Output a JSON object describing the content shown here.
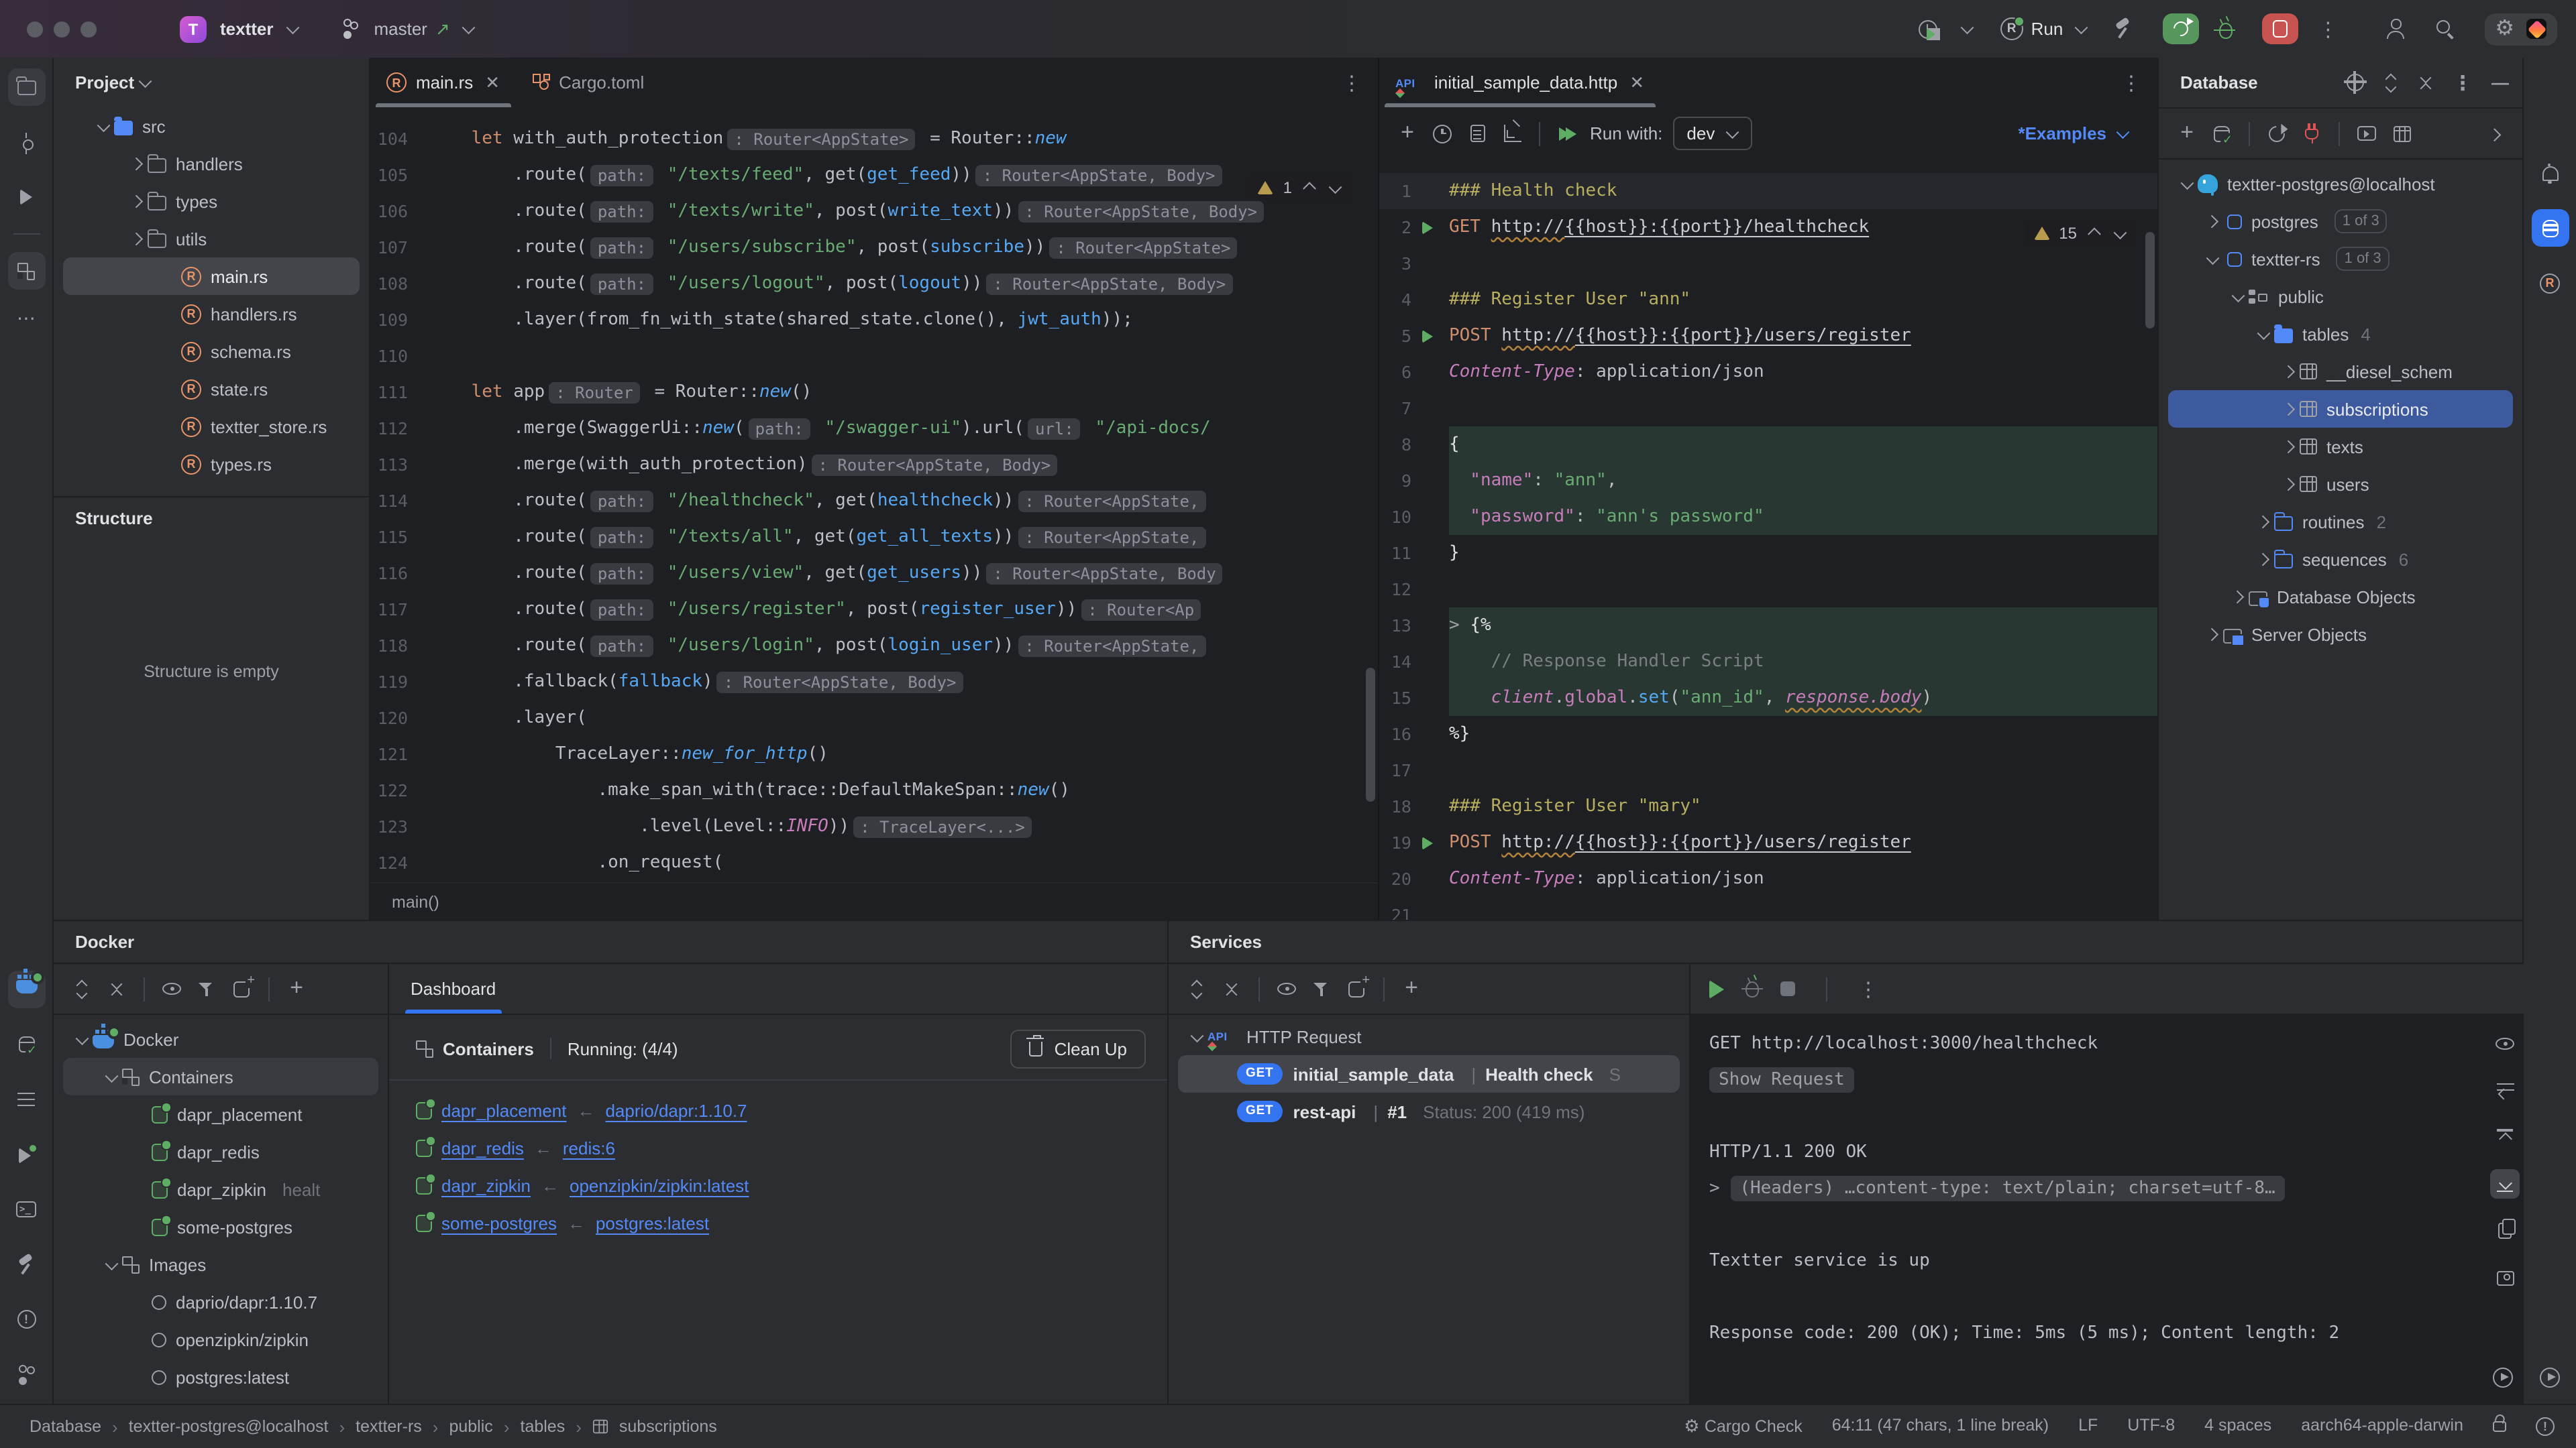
{
  "colors": {
    "accent": "#3574f0",
    "run_green": "#5fad65",
    "stop_red": "#c75450",
    "warning_gold": "#b89b4e",
    "link_blue": "#548af7",
    "selection_blue": "#3d5a9e",
    "panel_bg": "#2b2d30",
    "editor_bg": "#1e1f22"
  },
  "titlebar": {
    "project_initial": "T",
    "project": "textter",
    "branch": "master",
    "run_config": "Run"
  },
  "project_pane": {
    "title": "Project",
    "tree": [
      {
        "i": 0,
        "c": "d",
        "ic": "folder-blue",
        "l": "src"
      },
      {
        "i": 1,
        "c": "r",
        "ic": "folder",
        "l": "handlers"
      },
      {
        "i": 1,
        "c": "r",
        "ic": "folder",
        "l": "types"
      },
      {
        "i": 1,
        "c": "r",
        "ic": "folder",
        "l": "utils"
      },
      {
        "i": 2,
        "ic": "rust",
        "l": "main.rs",
        "sel": true
      },
      {
        "i": 2,
        "ic": "rust",
        "l": "handlers.rs"
      },
      {
        "i": 2,
        "ic": "rust",
        "l": "schema.rs"
      },
      {
        "i": 2,
        "ic": "rust",
        "l": "state.rs"
      },
      {
        "i": 2,
        "ic": "rust",
        "l": "textter_store.rs"
      },
      {
        "i": 2,
        "ic": "rust",
        "l": "types.rs"
      }
    ]
  },
  "structure": {
    "title": "Structure",
    "empty": "Structure is empty"
  },
  "tabs": {
    "main": "main.rs",
    "cargo": "Cargo.toml"
  },
  "code": {
    "warn_count": "1",
    "breadcrumb": "main()",
    "lines": [
      {
        "n": 104,
        "seg": [
          [
            "k",
            "    let "
          ],
          [
            "t",
            "with_auth_protection"
          ],
          [
            "h",
            ": Router<AppState>"
          ],
          [
            "t",
            " = Router::"
          ],
          [
            "fi",
            "new"
          ]
        ]
      },
      {
        "n": 105,
        "seg": [
          [
            "t",
            "        .route("
          ],
          [
            "h",
            "path:"
          ],
          [
            "s",
            " \"/texts/feed\""
          ],
          [
            "t",
            ", get("
          ],
          [
            "f",
            "get_feed"
          ],
          [
            "t",
            "))"
          ],
          [
            "h",
            ": Router<AppState, Body>"
          ]
        ]
      },
      {
        "n": 106,
        "seg": [
          [
            "t",
            "        .route("
          ],
          [
            "h",
            "path:"
          ],
          [
            "s",
            " \"/texts/write\""
          ],
          [
            "t",
            ", post("
          ],
          [
            "f",
            "write_text"
          ],
          [
            "t",
            "))"
          ],
          [
            "h",
            ": Router<AppState, Body>"
          ]
        ]
      },
      {
        "n": 107,
        "seg": [
          [
            "t",
            "        .route("
          ],
          [
            "h",
            "path:"
          ],
          [
            "s",
            " \"/users/subscribe\""
          ],
          [
            "t",
            ", post("
          ],
          [
            "f",
            "subscribe"
          ],
          [
            "t",
            "))"
          ],
          [
            "h",
            ": Router<AppState>"
          ]
        ]
      },
      {
        "n": 108,
        "seg": [
          [
            "t",
            "        .route("
          ],
          [
            "h",
            "path:"
          ],
          [
            "s",
            " \"/users/logout\""
          ],
          [
            "t",
            ", post("
          ],
          [
            "f",
            "logout"
          ],
          [
            "t",
            "))"
          ],
          [
            "h",
            ": Router<AppState, Body>"
          ]
        ]
      },
      {
        "n": 109,
        "seg": [
          [
            "t",
            "        .layer(from_fn_with_state(shared_state.clone(), "
          ],
          [
            "f",
            "jwt_auth"
          ],
          [
            "t",
            "));"
          ]
        ]
      },
      {
        "n": 110,
        "seg": []
      },
      {
        "n": 111,
        "seg": [
          [
            "k",
            "    let "
          ],
          [
            "t",
            "app"
          ],
          [
            "h",
            ": Router"
          ],
          [
            "t",
            " = Router::"
          ],
          [
            "fi",
            "new"
          ],
          [
            "t",
            "()"
          ]
        ]
      },
      {
        "n": 112,
        "seg": [
          [
            "t",
            "        .merge(SwaggerUi::"
          ],
          [
            "fi",
            "new"
          ],
          [
            "t",
            "("
          ],
          [
            "h",
            "path:"
          ],
          [
            "s",
            " \"/swagger-ui\""
          ],
          [
            "t",
            ").url("
          ],
          [
            "h",
            "url:"
          ],
          [
            "s",
            " \"/api-docs/"
          ]
        ]
      },
      {
        "n": 113,
        "seg": [
          [
            "t",
            "        .merge(with_auth_protection)"
          ],
          [
            "h",
            ": Router<AppState, Body>"
          ]
        ]
      },
      {
        "n": 114,
        "seg": [
          [
            "t",
            "        .route("
          ],
          [
            "h",
            "path:"
          ],
          [
            "s",
            " \"/healthcheck\""
          ],
          [
            "t",
            ", get("
          ],
          [
            "f",
            "healthcheck"
          ],
          [
            "t",
            "))"
          ],
          [
            "h",
            ": Router<AppState,"
          ]
        ]
      },
      {
        "n": 115,
        "seg": [
          [
            "t",
            "        .route("
          ],
          [
            "h",
            "path:"
          ],
          [
            "s",
            " \"/texts/all\""
          ],
          [
            "t",
            ", get("
          ],
          [
            "f",
            "get_all_texts"
          ],
          [
            "t",
            "))"
          ],
          [
            "h",
            ": Router<AppState,"
          ]
        ]
      },
      {
        "n": 116,
        "seg": [
          [
            "t",
            "        .route("
          ],
          [
            "h",
            "path:"
          ],
          [
            "s",
            " \"/users/view\""
          ],
          [
            "t",
            ", get("
          ],
          [
            "f",
            "get_users"
          ],
          [
            "t",
            "))"
          ],
          [
            "h",
            ": Router<AppState, Body"
          ]
        ]
      },
      {
        "n": 117,
        "seg": [
          [
            "t",
            "        .route("
          ],
          [
            "h",
            "path:"
          ],
          [
            "s",
            " \"/users/register\""
          ],
          [
            "t",
            ", post("
          ],
          [
            "f",
            "register_user"
          ],
          [
            "t",
            "))"
          ],
          [
            "h",
            ": Router<Ap"
          ]
        ]
      },
      {
        "n": 118,
        "seg": [
          [
            "t",
            "        .route("
          ],
          [
            "h",
            "path:"
          ],
          [
            "s",
            " \"/users/login\""
          ],
          [
            "t",
            ", post("
          ],
          [
            "f",
            "login_user"
          ],
          [
            "t",
            "))"
          ],
          [
            "h",
            ": Router<AppState,"
          ]
        ]
      },
      {
        "n": 119,
        "seg": [
          [
            "t",
            "        .fallback("
          ],
          [
            "f",
            "fallback"
          ],
          [
            "t",
            ")"
          ],
          [
            "h",
            ": Router<AppState, Body>"
          ]
        ]
      },
      {
        "n": 120,
        "seg": [
          [
            "t",
            "        .layer("
          ]
        ]
      },
      {
        "n": 121,
        "seg": [
          [
            "t",
            "            TraceLayer::"
          ],
          [
            "fi",
            "new_for_http"
          ],
          [
            "t",
            "()"
          ]
        ]
      },
      {
        "n": 122,
        "seg": [
          [
            "t",
            "                .make_span_with(trace::DefaultMakeSpan::"
          ],
          [
            "fi",
            "new"
          ],
          [
            "t",
            "()"
          ]
        ]
      },
      {
        "n": 123,
        "seg": [
          [
            "t",
            "                    .level(Level::"
          ],
          [
            "pi",
            "INFO"
          ],
          [
            "t",
            "))"
          ],
          [
            "h",
            ": TraceLayer<...>"
          ]
        ]
      },
      {
        "n": 124,
        "seg": [
          [
            "t",
            "                .on_request("
          ]
        ]
      }
    ]
  },
  "http": {
    "tab_label": "initial_sample_data.http",
    "warn_count": "15",
    "toolbar": {
      "run_with": "Run with:",
      "env": "dev",
      "examples": "*Examples"
    },
    "lines": [
      {
        "n": 1,
        "bg": "hl",
        "seg": [
          [
            "y",
            "### Health check"
          ]
        ]
      },
      {
        "n": 2,
        "run": true,
        "seg": [
          [
            "k",
            "GET "
          ],
          [
            "uw",
            "http://"
          ],
          [
            "u",
            "{{host}}:{{port}}/healthcheck"
          ]
        ]
      },
      {
        "n": 3,
        "seg": []
      },
      {
        "n": 4,
        "seg": [
          [
            "y",
            "### Register User \"ann\""
          ]
        ]
      },
      {
        "n": 5,
        "run": true,
        "seg": [
          [
            "k",
            "POST "
          ],
          [
            "uw",
            "http://"
          ],
          [
            "u",
            "{{host}}:{{port}}/users/register"
          ]
        ]
      },
      {
        "n": 6,
        "seg": [
          [
            "pi",
            "Content-Type"
          ],
          [
            "t",
            ": application/json"
          ]
        ]
      },
      {
        "n": 7,
        "seg": []
      },
      {
        "n": 8,
        "bg": "json",
        "seg": [
          [
            "w",
            "{"
          ]
        ]
      },
      {
        "n": 9,
        "bg": "json",
        "seg": [
          [
            "p",
            "  \"name\""
          ],
          [
            "t",
            ": "
          ],
          [
            "s",
            "\"ann\""
          ],
          [
            "t",
            ","
          ]
        ]
      },
      {
        "n": 10,
        "bg": "json",
        "seg": [
          [
            "p",
            "  \"password\""
          ],
          [
            "t",
            ": "
          ],
          [
            "s",
            "\"ann's password\""
          ]
        ]
      },
      {
        "n": 11,
        "seg": [
          [
            "w",
            "}"
          ]
        ]
      },
      {
        "n": 12,
        "seg": []
      },
      {
        "n": 13,
        "bg": "json",
        "seg": [
          [
            "fold",
            "> "
          ],
          [
            "w",
            "{%"
          ]
        ]
      },
      {
        "n": 14,
        "bg": "json",
        "seg": [
          [
            "c",
            "    // Response Handler Script"
          ]
        ]
      },
      {
        "n": 15,
        "bg": "json",
        "seg": [
          [
            "pi",
            "    client"
          ],
          [
            "t",
            "."
          ],
          [
            "p",
            "global"
          ],
          [
            "t",
            "."
          ],
          [
            "f",
            "set"
          ],
          [
            "t",
            "("
          ],
          [
            "s",
            "\"ann_id\""
          ],
          [
            "t",
            ", "
          ],
          [
            "piu",
            "response.body"
          ],
          [
            "t",
            ")"
          ]
        ]
      },
      {
        "n": 16,
        "seg": [
          [
            "w",
            "%}"
          ]
        ]
      },
      {
        "n": 17,
        "seg": []
      },
      {
        "n": 18,
        "seg": [
          [
            "y",
            "### Register User \"mary\""
          ]
        ]
      },
      {
        "n": 19,
        "run": true,
        "seg": [
          [
            "k",
            "POST "
          ],
          [
            "uw",
            "http://"
          ],
          [
            "u",
            "{{host}}:{{port}}/users/register"
          ]
        ]
      },
      {
        "n": 20,
        "seg": [
          [
            "pi",
            "Content-Type"
          ],
          [
            "t",
            ": application/json"
          ]
        ]
      },
      {
        "n": 21,
        "seg": []
      }
    ]
  },
  "database": {
    "title": "Database",
    "tree": [
      {
        "i": 0,
        "c": "d",
        "ic": "pg",
        "l": "textter-postgres@localhost"
      },
      {
        "i": 1,
        "c": "r",
        "ic": "db",
        "l": "postgres",
        "chip": "1 of 3"
      },
      {
        "i": 1,
        "c": "d",
        "ic": "db",
        "l": "textter-rs",
        "chip": "1 of 3"
      },
      {
        "i": 2,
        "c": "d",
        "ic": "schema",
        "l": "public"
      },
      {
        "i": 3,
        "c": "d",
        "ic": "folder-blue",
        "l": "tables",
        "cnt": "4"
      },
      {
        "i": 4,
        "c": "r",
        "ic": "table",
        "l": "__diesel_schem"
      },
      {
        "i": 4,
        "c": "r",
        "ic": "table",
        "l": "subscriptions",
        "sel": true
      },
      {
        "i": 4,
        "c": "r",
        "ic": "table",
        "l": "texts"
      },
      {
        "i": 4,
        "c": "r",
        "ic": "table",
        "l": "users"
      },
      {
        "i": 3,
        "c": "r",
        "ic": "folder-outline",
        "l": "routines",
        "cnt": "2"
      },
      {
        "i": 3,
        "c": "r",
        "ic": "folder-outline",
        "l": "sequences",
        "cnt": "6"
      },
      {
        "i": 2,
        "c": "r",
        "ic": "dbobj",
        "l": "Database Objects"
      },
      {
        "i": 1,
        "c": "r",
        "ic": "srvobj",
        "l": "Server Objects"
      }
    ]
  },
  "docker": {
    "title": "Docker",
    "tree": [
      {
        "i": 0,
        "c": "d",
        "ic": "docker",
        "l": "Docker"
      },
      {
        "i": 1,
        "c": "d",
        "ic": "boxes",
        "l": "Containers",
        "hov": true
      },
      {
        "i": 2,
        "ic": "cont",
        "l": "dapr_placement"
      },
      {
        "i": 2,
        "ic": "cont",
        "l": "dapr_redis"
      },
      {
        "i": 2,
        "ic": "cont",
        "l": "dapr_zipkin",
        "dim": "healt"
      },
      {
        "i": 2,
        "ic": "cont",
        "l": "some-postgres"
      },
      {
        "i": 1,
        "c": "d",
        "ic": "boxes",
        "l": "Images"
      },
      {
        "i": 2,
        "ic": "circle",
        "l": "daprio/dapr:1.10.7"
      },
      {
        "i": 2,
        "ic": "circle",
        "l": "openzipkin/zipkin"
      },
      {
        "i": 2,
        "ic": "circle",
        "l": "postgres:latest"
      }
    ],
    "dashboard": {
      "tab": "Dashboard",
      "containers_label": "Containers",
      "running": "Running: (4/4)",
      "cleanup": "Clean Up",
      "links": [
        {
          "name": "dapr_placement",
          "image": "daprio/dapr:1.10.7"
        },
        {
          "name": "dapr_redis",
          "image": "redis:6"
        },
        {
          "name": "dapr_zipkin",
          "image": "openzipkin/zipkin:latest"
        },
        {
          "name": "some-postgres",
          "image": "postgres:latest"
        }
      ]
    }
  },
  "services": {
    "title": "Services",
    "tree": [
      {
        "i": 0,
        "c": "d",
        "ic": "api",
        "l": "HTTP Request"
      },
      {
        "i": 1,
        "badge": "GET",
        "l": "initial_sample_data",
        "sep": "|",
        "sub": "Health check",
        "dim": "S",
        "sel": true
      },
      {
        "i": 1,
        "badge": "GET",
        "l": "rest-api",
        "sep": "|",
        "sub": "#1",
        "dim": "Status: 200 (419 ms)"
      }
    ]
  },
  "response": {
    "lines": [
      {
        "seg": [
          [
            "rt",
            "GET http://localhost:3000/healthcheck"
          ]
        ]
      },
      {
        "seg": [
          [
            "chip",
            "Show Request"
          ]
        ]
      },
      {
        "seg": []
      },
      {
        "seg": [
          [
            "rt",
            "HTTP/1.1 200 OK"
          ]
        ]
      },
      {
        "seg": [
          [
            "fold",
            "> "
          ],
          [
            "hchip",
            "(Headers) …content-type: text/plain; charset=utf-8…"
          ]
        ]
      },
      {
        "seg": []
      },
      {
        "seg": [
          [
            "rt",
            "Textter service is up"
          ]
        ]
      },
      {
        "seg": []
      },
      {
        "seg": [
          [
            "rt",
            "Response code: 200 (OK); Time: 5ms (5 ms); Content length: 2"
          ]
        ]
      }
    ]
  },
  "statusbar": {
    "crumbs": [
      "Database",
      "textter-postgres@localhost",
      "textter-rs",
      "public",
      "tables",
      "subscriptions"
    ],
    "right": [
      "Cargo Check",
      "64:11 (47 chars, 1 line break)",
      "LF",
      "UTF-8",
      "4 spaces",
      "aarch64-apple-darwin"
    ]
  }
}
